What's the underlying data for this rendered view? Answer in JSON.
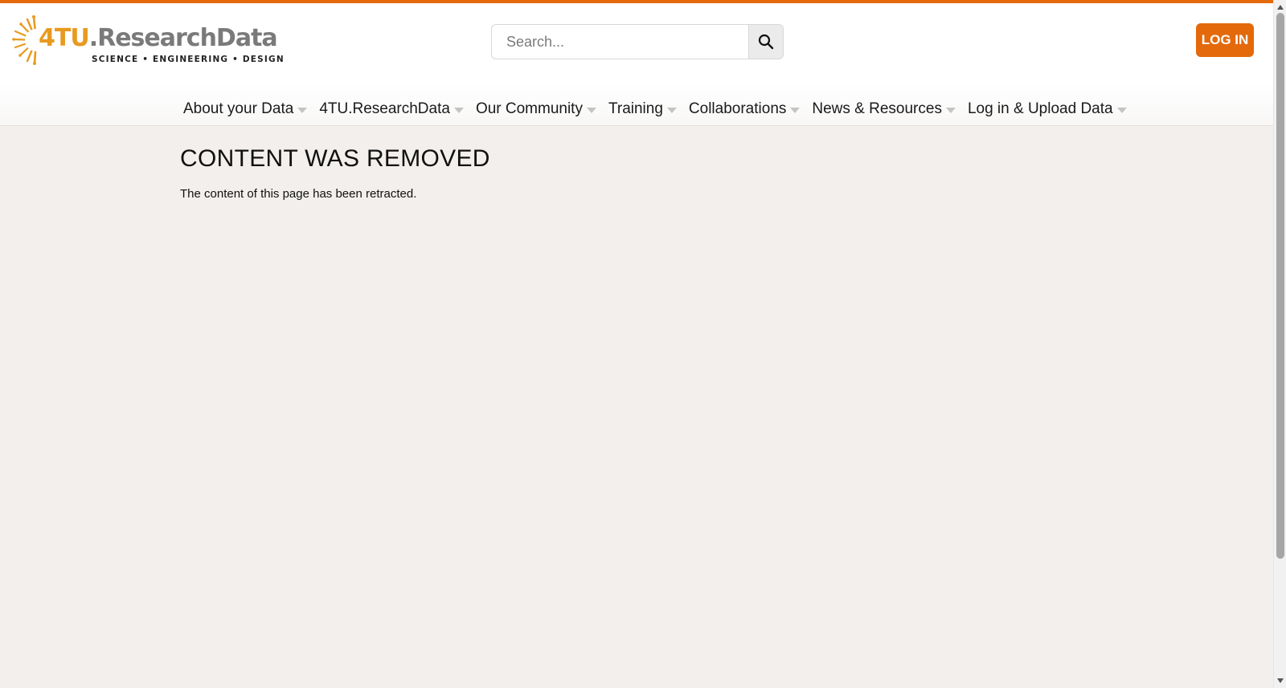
{
  "brand": {
    "name_part1": "4TU",
    "name_part2": ".ResearchData",
    "tagline": "SCIENCE • ENGINEERING • DESIGN",
    "primary_color": "#e3690b",
    "logo_orange": "#e89a1f",
    "logo_gray": "#7a7a7a"
  },
  "search": {
    "placeholder": "Search...",
    "value": "",
    "icon": "search-icon"
  },
  "header": {
    "login_label": "LOG IN"
  },
  "nav": {
    "items": [
      {
        "label": "About your Data"
      },
      {
        "label": "4TU.ResearchData"
      },
      {
        "label": "Our Community"
      },
      {
        "label": "Training"
      },
      {
        "label": "Collaborations"
      },
      {
        "label": "News & Resources"
      },
      {
        "label": "Log in & Upload Data"
      }
    ]
  },
  "main": {
    "title": "CONTENT WAS REMOVED",
    "message": "The content of this page has been retracted."
  },
  "colors": {
    "page_background": "#f2efec",
    "header_background": "#ffffff"
  }
}
